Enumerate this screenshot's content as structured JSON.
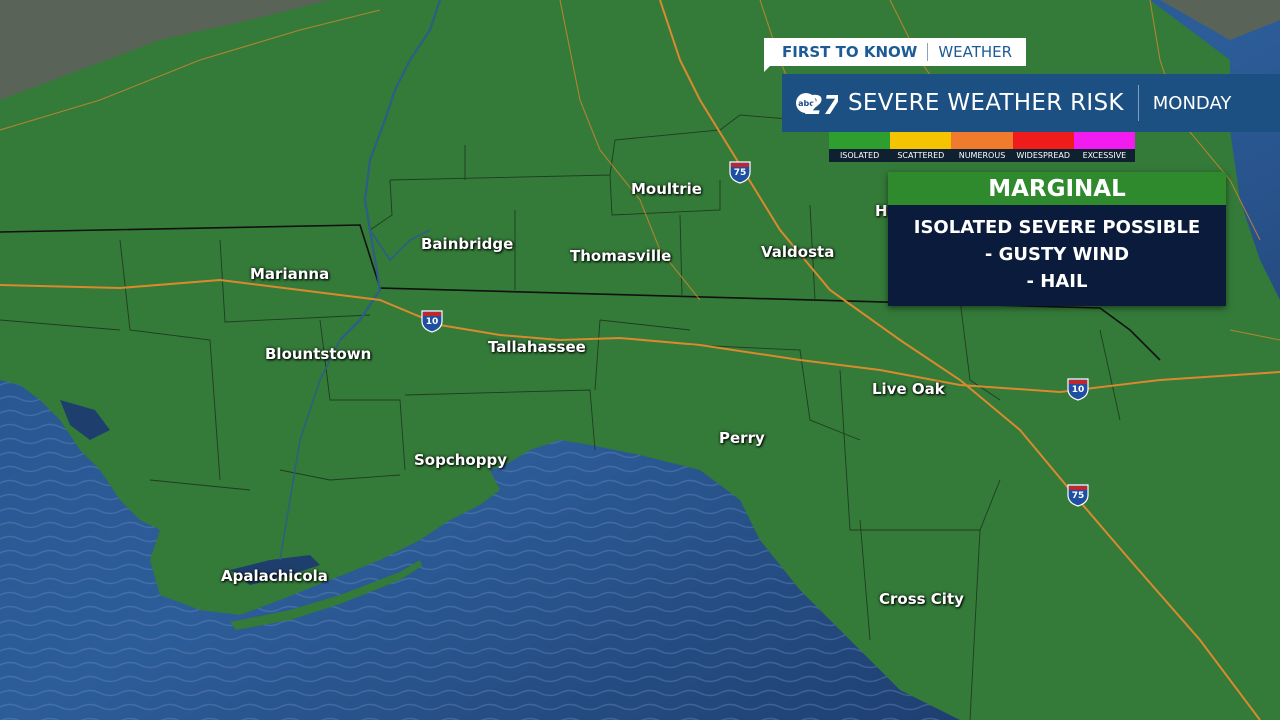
{
  "branding": {
    "first_to_know": "FIRST TO KNOW",
    "weather": "WEATHER",
    "station_logo_small": "abc",
    "station_logo_number": "27"
  },
  "header": {
    "title": "SEVERE WEATHER RISK",
    "day": "MONDAY"
  },
  "risk_scale": [
    {
      "label": "ISOLATED",
      "color": "#2e9e2f"
    },
    {
      "label": "SCATTERED",
      "color": "#f5c400"
    },
    {
      "label": "NUMEROUS",
      "color": "#f07b2c"
    },
    {
      "label": "WIDESPREAD",
      "color": "#f01c1c"
    },
    {
      "label": "EXCESSIVE",
      "color": "#f21cf0"
    }
  ],
  "risk_box": {
    "level": "MARGINAL",
    "lines": [
      "ISOLATED SEVERE POSSIBLE",
      "- GUSTY WIND",
      "- HAIL"
    ]
  },
  "cities": {
    "moultrie": "Moultrie",
    "bainbridge": "Bainbridge",
    "thomasville": "Thomasville",
    "valdosta": "Valdosta",
    "marianna": "Marianna",
    "blountstown": "Blountstown",
    "tallahassee": "Tallahassee",
    "live_oak": "Live Oak",
    "perry": "Perry",
    "sopchoppy": "Sopchoppy",
    "apalachicola": "Apalachicola",
    "cross_city": "Cross City",
    "partial_h": "H"
  },
  "shields": {
    "i75_north": "75",
    "i10_west": "10",
    "i10_east": "10",
    "i75_south": "75"
  },
  "colors": {
    "land": "#347a39",
    "water": "#1e3f6e",
    "highway": "#d98a2e",
    "outside_risk": "#5a6358"
  }
}
